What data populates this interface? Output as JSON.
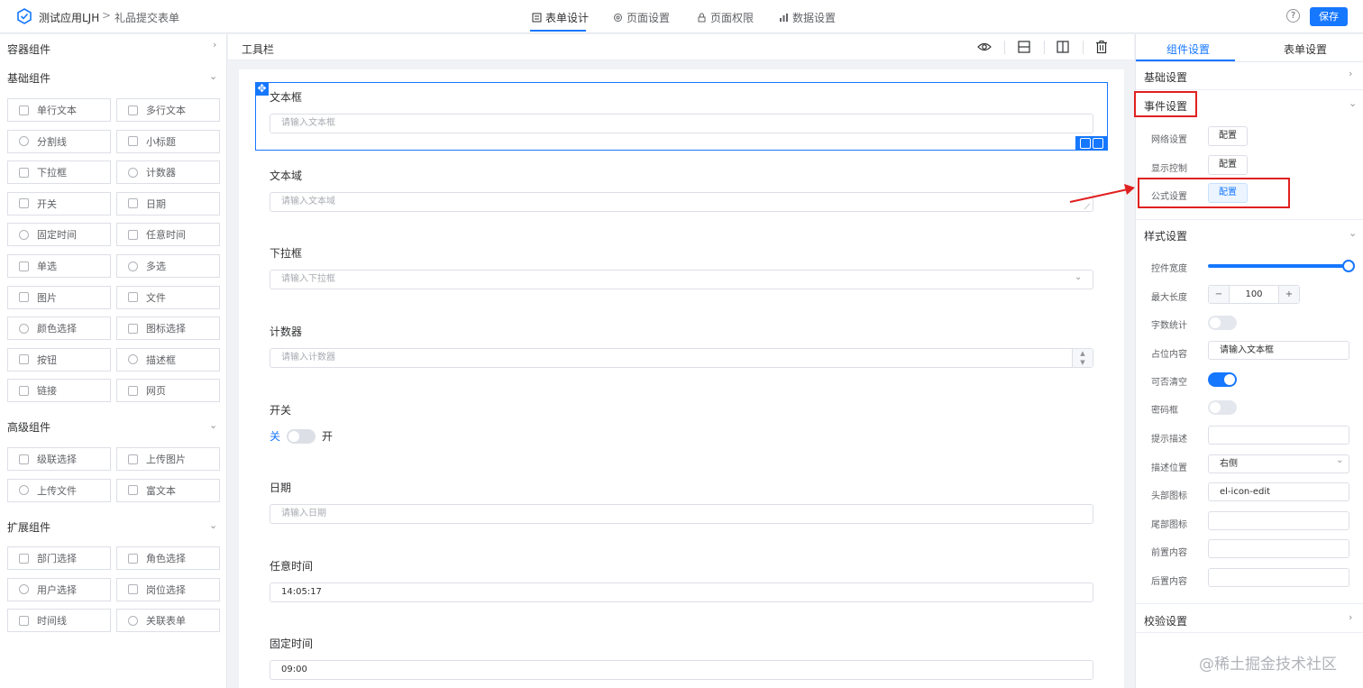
{
  "header": {
    "app_title": "测试应用LJH",
    "separator": ">",
    "page_name": "礼品提交表单",
    "tabs": [
      {
        "label": "表单设计",
        "active": true,
        "icon": "form-icon"
      },
      {
        "label": "页面设置",
        "active": false,
        "icon": "gear-icon"
      },
      {
        "label": "页面权限",
        "active": false,
        "icon": "lock-icon"
      },
      {
        "label": "数据设置",
        "active": false,
        "icon": "chart-icon"
      }
    ],
    "help_glyph": "?",
    "save_label": "保存"
  },
  "left_panel": {
    "container_group": "容器组件",
    "basic_group": "基础组件",
    "basic_items": [
      "单行文本",
      "多行文本",
      "分割线",
      "小标题",
      "下拉框",
      "计数器",
      "开关",
      "日期",
      "固定时间",
      "任意时间",
      "单选",
      "多选",
      "图片",
      "文件",
      "颜色选择",
      "图标选择",
      "按钮",
      "描述框",
      "链接",
      "网页"
    ],
    "advanced_group": "高级组件",
    "advanced_items": [
      "级联选择",
      "上传图片",
      "上传文件",
      "富文本"
    ],
    "extension_group": "扩展组件",
    "extension_items": [
      "部门选择",
      "角色选择",
      "用户选择",
      "岗位选择",
      "时间线",
      "关联表单"
    ]
  },
  "center": {
    "toolbar_label": "工具栏",
    "fields": [
      {
        "label": "文本框",
        "placeholder": "请输入文本框"
      },
      {
        "label": "文本域",
        "placeholder": "请输入文本域"
      },
      {
        "label": "下拉框",
        "placeholder": "请输入下拉框"
      },
      {
        "label": "计数器",
        "placeholder": "请输入计数器"
      },
      {
        "label": "开关",
        "off_text": "关",
        "on_text": "开"
      },
      {
        "label": "日期",
        "placeholder": "请输入日期"
      },
      {
        "label": "任意时间",
        "value": "14:05:17"
      },
      {
        "label": "固定时间",
        "value": "09:00"
      }
    ]
  },
  "right_panel": {
    "tabs": [
      "组件设置",
      "表单设置"
    ],
    "basic_settings": "基础设置",
    "event_settings": "事件设置",
    "event_rows": [
      {
        "label": "网络设置",
        "button": "配置"
      },
      {
        "label": "显示控制",
        "button": "配置"
      },
      {
        "label": "公式设置",
        "button": "配置"
      }
    ],
    "style_settings": "样式设置",
    "style_rows": {
      "width_label": "控件宽度",
      "width_value": 1.0,
      "maxlen_label": "最大长度",
      "maxlen_value": "100",
      "minus": "−",
      "plus": "+",
      "wordcount_label": "字数统计",
      "placeholder_label": "占位内容",
      "placeholder_value": "请输入文本框",
      "clearable_label": "可否清空",
      "password_label": "密码框",
      "hint_label": "提示描述",
      "desc_pos_label": "描述位置",
      "desc_pos_value": "右侧",
      "head_icon_label": "头部图标",
      "head_icon_value": "el-icon-edit",
      "tail_icon_label": "尾部图标",
      "prefix_label": "前置内容",
      "suffix_label": "后置内容"
    },
    "validation_settings": "校验设置"
  },
  "watermark": "@稀土掘金技术社区",
  "colors": {
    "accent": "#1677ff",
    "annotation": "#e02020"
  }
}
